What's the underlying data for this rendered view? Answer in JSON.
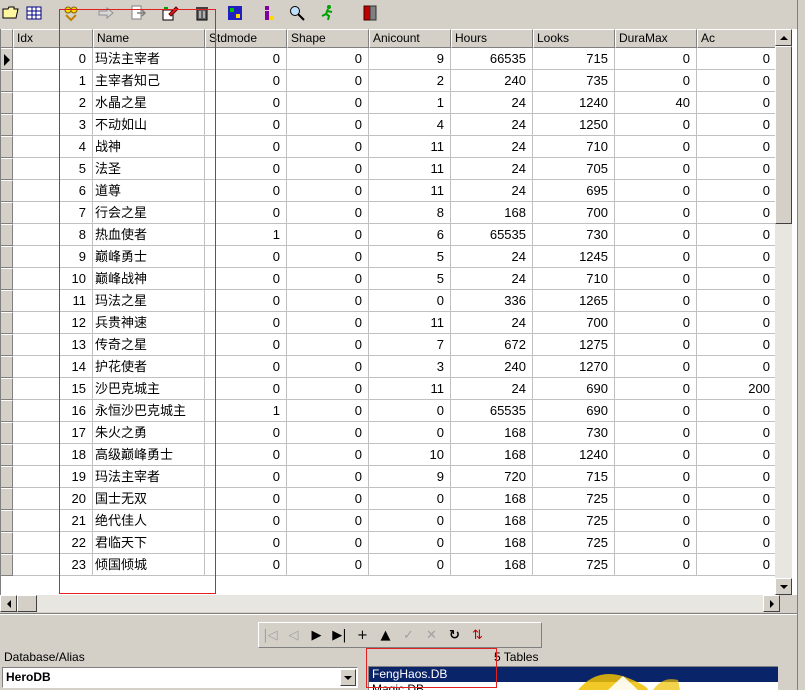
{
  "toolbar": {
    "buttons": [
      {
        "icon": "open-folder-icon"
      },
      {
        "icon": "grid-view-icon"
      },
      {
        "icon": "filter-icon"
      },
      {
        "icon": "arrow-right-icon"
      },
      {
        "icon": "export-icon"
      },
      {
        "icon": "edit-pen-icon"
      },
      {
        "icon": "delete-trash-icon"
      },
      {
        "icon": "sql-query-icon"
      },
      {
        "icon": "info-icon"
      },
      {
        "icon": "search-icon"
      },
      {
        "icon": "run-person-icon"
      },
      {
        "icon": "exit-door-icon"
      }
    ]
  },
  "grid": {
    "columns": [
      "Idx",
      "Name",
      "Stdmode",
      "Shape",
      "Anicount",
      "Hours",
      "Looks",
      "DuraMax",
      "Ac"
    ],
    "rows": [
      {
        "idx": "0",
        "name": "玛法主宰者",
        "stdmode": "0",
        "shape": "0",
        "anicount": "9",
        "hours": "66535",
        "looks": "715",
        "duramax": "0",
        "ac": "0"
      },
      {
        "idx": "1",
        "name": "主宰者知己",
        "stdmode": "0",
        "shape": "0",
        "anicount": "2",
        "hours": "240",
        "looks": "735",
        "duramax": "0",
        "ac": "0"
      },
      {
        "idx": "2",
        "name": "水晶之星",
        "stdmode": "0",
        "shape": "0",
        "anicount": "1",
        "hours": "24",
        "looks": "1240",
        "duramax": "40",
        "ac": "0"
      },
      {
        "idx": "3",
        "name": "不动如山",
        "stdmode": "0",
        "shape": "0",
        "anicount": "4",
        "hours": "24",
        "looks": "1250",
        "duramax": "0",
        "ac": "0"
      },
      {
        "idx": "4",
        "name": "战神",
        "stdmode": "0",
        "shape": "0",
        "anicount": "11",
        "hours": "24",
        "looks": "710",
        "duramax": "0",
        "ac": "0"
      },
      {
        "idx": "5",
        "name": "法圣",
        "stdmode": "0",
        "shape": "0",
        "anicount": "11",
        "hours": "24",
        "looks": "705",
        "duramax": "0",
        "ac": "0"
      },
      {
        "idx": "6",
        "name": "道尊",
        "stdmode": "0",
        "shape": "0",
        "anicount": "11",
        "hours": "24",
        "looks": "695",
        "duramax": "0",
        "ac": "0"
      },
      {
        "idx": "7",
        "name": "行会之星",
        "stdmode": "0",
        "shape": "0",
        "anicount": "8",
        "hours": "168",
        "looks": "700",
        "duramax": "0",
        "ac": "0"
      },
      {
        "idx": "8",
        "name": "热血使者",
        "stdmode": "1",
        "shape": "0",
        "anicount": "6",
        "hours": "65535",
        "looks": "730",
        "duramax": "0",
        "ac": "0"
      },
      {
        "idx": "9",
        "name": "巅峰勇士",
        "stdmode": "0",
        "shape": "0",
        "anicount": "5",
        "hours": "24",
        "looks": "1245",
        "duramax": "0",
        "ac": "0"
      },
      {
        "idx": "10",
        "name": "巅峰战神",
        "stdmode": "0",
        "shape": "0",
        "anicount": "5",
        "hours": "24",
        "looks": "710",
        "duramax": "0",
        "ac": "0"
      },
      {
        "idx": "11",
        "name": "玛法之星",
        "stdmode": "0",
        "shape": "0",
        "anicount": "0",
        "hours": "336",
        "looks": "1265",
        "duramax": "0",
        "ac": "0"
      },
      {
        "idx": "12",
        "name": "兵贵神速",
        "stdmode": "0",
        "shape": "0",
        "anicount": "11",
        "hours": "24",
        "looks": "700",
        "duramax": "0",
        "ac": "0"
      },
      {
        "idx": "13",
        "name": "传奇之星",
        "stdmode": "0",
        "shape": "0",
        "anicount": "7",
        "hours": "672",
        "looks": "1275",
        "duramax": "0",
        "ac": "0"
      },
      {
        "idx": "14",
        "name": "护花使者",
        "stdmode": "0",
        "shape": "0",
        "anicount": "3",
        "hours": "240",
        "looks": "1270",
        "duramax": "0",
        "ac": "0"
      },
      {
        "idx": "15",
        "name": "沙巴克城主",
        "stdmode": "0",
        "shape": "0",
        "anicount": "11",
        "hours": "24",
        "looks": "690",
        "duramax": "0",
        "ac": "200"
      },
      {
        "idx": "16",
        "name": "永恒沙巴克城主",
        "stdmode": "1",
        "shape": "0",
        "anicount": "0",
        "hours": "65535",
        "looks": "690",
        "duramax": "0",
        "ac": "0"
      },
      {
        "idx": "17",
        "name": "朱火之勇",
        "stdmode": "0",
        "shape": "0",
        "anicount": "0",
        "hours": "168",
        "looks": "730",
        "duramax": "0",
        "ac": "0"
      },
      {
        "idx": "18",
        "name": "高级巅峰勇士",
        "stdmode": "0",
        "shape": "0",
        "anicount": "10",
        "hours": "168",
        "looks": "1240",
        "duramax": "0",
        "ac": "0"
      },
      {
        "idx": "19",
        "name": "玛法主宰者",
        "stdmode": "0",
        "shape": "0",
        "anicount": "9",
        "hours": "720",
        "looks": "715",
        "duramax": "0",
        "ac": "0"
      },
      {
        "idx": "20",
        "name": "国士无双",
        "stdmode": "0",
        "shape": "0",
        "anicount": "0",
        "hours": "168",
        "looks": "725",
        "duramax": "0",
        "ac": "0"
      },
      {
        "idx": "21",
        "name": "绝代佳人",
        "stdmode": "0",
        "shape": "0",
        "anicount": "0",
        "hours": "168",
        "looks": "725",
        "duramax": "0",
        "ac": "0"
      },
      {
        "idx": "22",
        "name": "君临天下",
        "stdmode": "0",
        "shape": "0",
        "anicount": "0",
        "hours": "168",
        "looks": "725",
        "duramax": "0",
        "ac": "0"
      },
      {
        "idx": "23",
        "name": "倾国倾城",
        "stdmode": "0",
        "shape": "0",
        "anicount": "0",
        "hours": "168",
        "looks": "725",
        "duramax": "0",
        "ac": "0"
      }
    ]
  },
  "navigator": {
    "buttons": [
      {
        "icon": "first-record-icon",
        "glyph": "|◁",
        "enabled": false
      },
      {
        "icon": "prior-record-icon",
        "glyph": "◁",
        "enabled": false
      },
      {
        "icon": "next-record-icon",
        "glyph": "▶",
        "enabled": true
      },
      {
        "icon": "last-record-icon",
        "glyph": "▶|",
        "enabled": true
      },
      {
        "icon": "insert-record-icon",
        "glyph": "+",
        "enabled": true
      },
      {
        "icon": "delete-record-icon",
        "glyph": "▲",
        "enabled": true
      },
      {
        "icon": "post-edit-icon",
        "glyph": "✓",
        "enabled": false
      },
      {
        "icon": "cancel-edit-icon",
        "glyph": "✕",
        "enabled": false
      },
      {
        "icon": "refresh-icon",
        "glyph": "↻",
        "enabled": true
      },
      {
        "icon": "filter-data-icon",
        "glyph": "⇅",
        "enabled": true
      }
    ]
  },
  "database": {
    "label": "Database/Alias",
    "value": "HeroDB"
  },
  "tables": {
    "count_label": "5 Tables",
    "items": [
      "FengHaos.DB",
      "Magic.DB"
    ]
  },
  "colors": {
    "highlight_box": "#e02020",
    "selection": "#0a246a"
  }
}
